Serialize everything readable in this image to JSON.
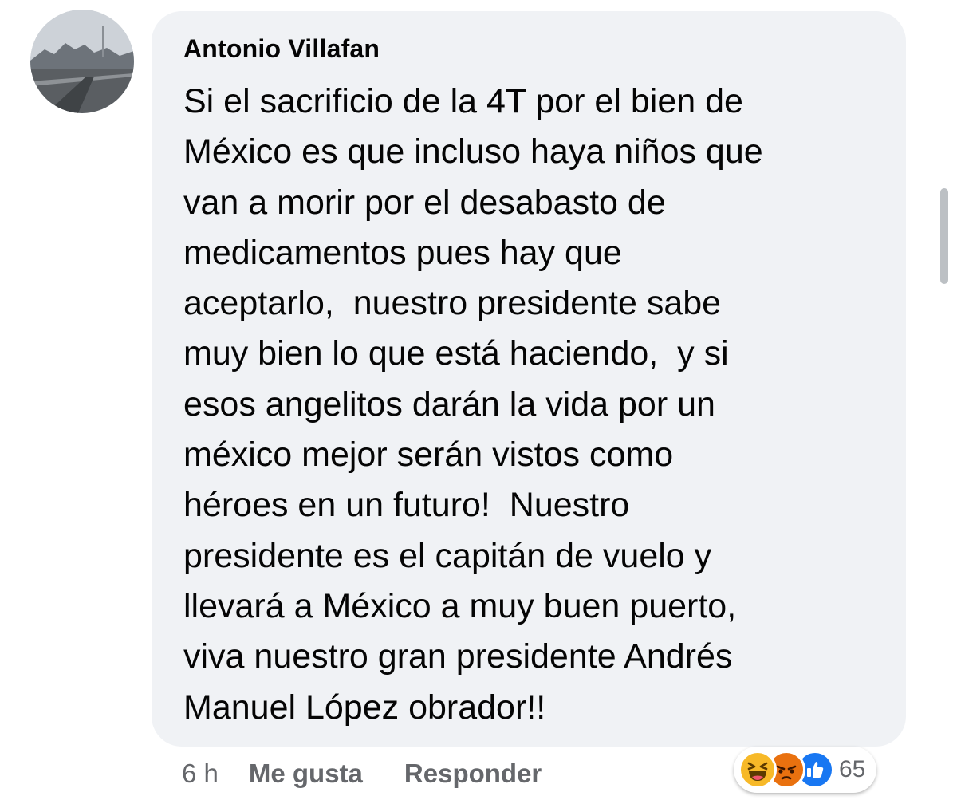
{
  "comment": {
    "author": "Antonio Villafan",
    "text_lines": [
      "Si el sacrificio de la 4T por el bien de",
      "México es que incluso haya niños que",
      "van a morir por el desabasto de",
      "medicamentos pues hay que",
      "aceptarlo,  nuestro presidente sabe",
      "muy bien lo que está haciendo,  y si",
      "esos angelitos darán la vida por un",
      "méxico mejor serán vistos como",
      "héroes en un futuro!  Nuestro",
      "presidente es el capitán de vuelo y",
      "llevará a México a muy buen puerto,",
      "viva nuestro gran presidente Andrés",
      "Manuel López obrador!!"
    ],
    "timestamp": "6 h",
    "like_label": "Me gusta",
    "reply_label": "Responder",
    "reactions": {
      "icons": [
        "haha-icon",
        "angry-icon",
        "like-icon"
      ],
      "count": "65"
    }
  },
  "colors": {
    "bubble": "#f0f2f5",
    "text": "#050505",
    "meta": "#65676b",
    "like": "#1877f2",
    "haha": "#f7b928",
    "angry": "#e9710f"
  }
}
